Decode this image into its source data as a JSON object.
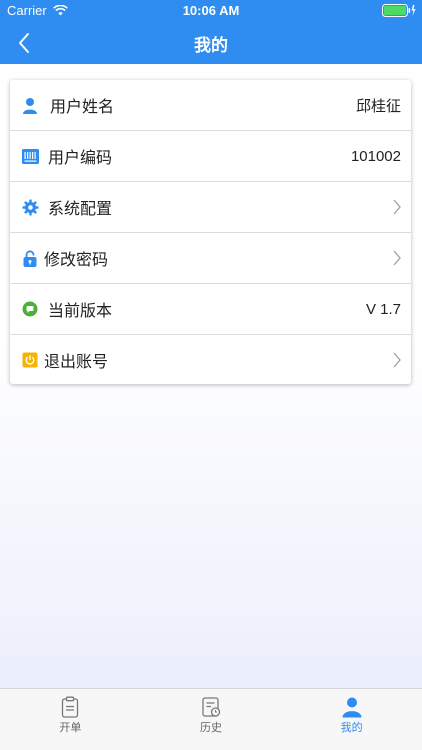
{
  "status": {
    "carrier": "Carrier",
    "time": "10:06 AM"
  },
  "nav": {
    "title": "我的"
  },
  "rows": [
    {
      "label": "用户姓名",
      "value": "邱桂征",
      "icon": "user-icon"
    },
    {
      "label": "用户编码",
      "value": "101002",
      "icon": "barcode-icon"
    },
    {
      "label": "系统配置",
      "value": "",
      "icon": "gear-icon"
    },
    {
      "label": "修改密码",
      "value": "",
      "icon": "lock-icon"
    },
    {
      "label": "当前版本",
      "value": "V 1.7",
      "icon": "version-icon"
    },
    {
      "label": "退出账号",
      "value": "",
      "icon": "power-icon"
    }
  ],
  "tabs": [
    {
      "label": "开单",
      "icon": "clipboard-icon"
    },
    {
      "label": "历史",
      "icon": "history-icon"
    },
    {
      "label": "我的",
      "icon": "person-icon"
    }
  ],
  "colors": {
    "primary": "#2f8cf0",
    "inactive": "#666666"
  }
}
